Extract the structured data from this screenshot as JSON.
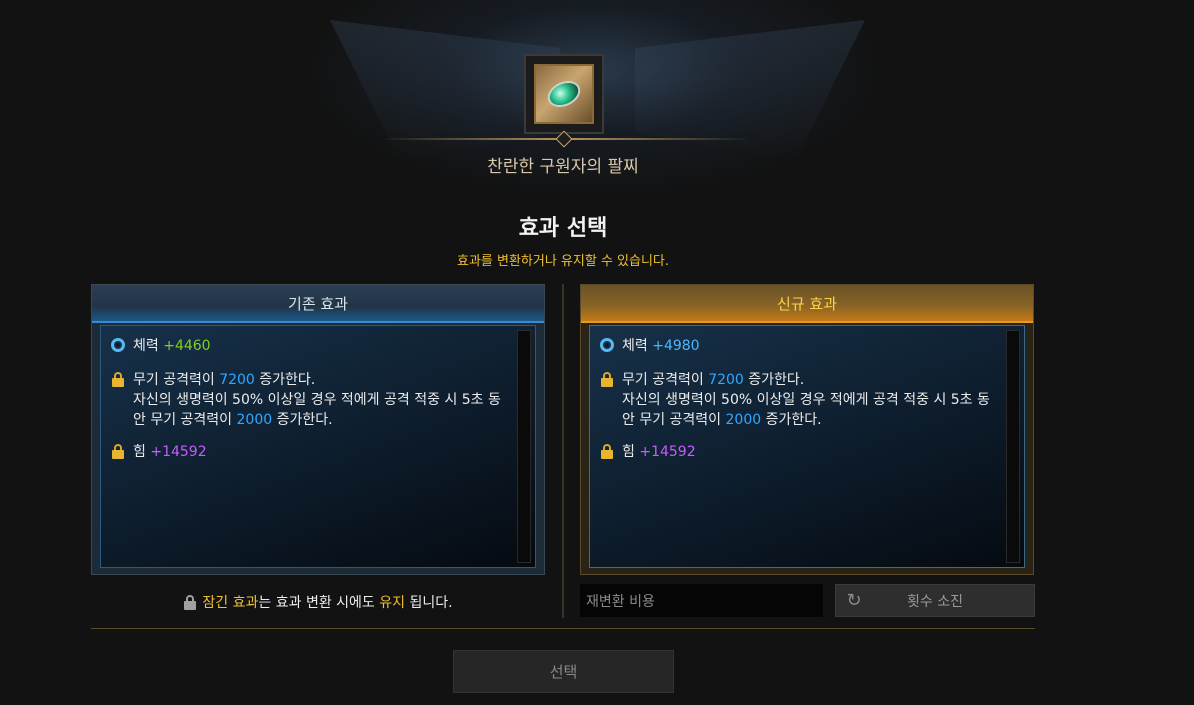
{
  "item": {
    "name": "찬란한 구원자의 팔찌",
    "icon": "bracelet-icon"
  },
  "header": {
    "title": "효과 선택",
    "subtitle": "효과를 변환하거나 유지할 수 있습니다."
  },
  "old_panel": {
    "title": "기존 효과",
    "effects": [
      {
        "icon": "stat-gear-icon",
        "label": "체력",
        "value": "+4460"
      },
      {
        "icon": "lock-icon",
        "line1_pre": "무기 공격력이 ",
        "line1_val": "7200",
        "line1_post": " 증가한다.",
        "line2": "자신의 생명력이 50% 이상일 경우 적에게 공격 적중 시 5초 동",
        "line3_pre": "안 무기 공격력이 ",
        "line3_val": "2000",
        "line3_post": " 증가한다."
      },
      {
        "icon": "lock-icon",
        "label": "힘",
        "value": "+14592"
      }
    ]
  },
  "new_panel": {
    "title": "신규 효과",
    "effects": [
      {
        "icon": "stat-gear-icon",
        "label": "체력",
        "value": "+4980"
      },
      {
        "icon": "lock-icon",
        "line1_pre": "무기 공격력이 ",
        "line1_val": "7200",
        "line1_post": " 증가한다.",
        "line2": "자신의 생명력이 50% 이상일 경우 적에게 공격 적중 시 5초 동",
        "line3_pre": "안 무기 공격력이 ",
        "line3_val": "2000",
        "line3_post": " 증가한다."
      },
      {
        "icon": "lock-icon",
        "label": "힘",
        "value": "+14592"
      }
    ]
  },
  "footnote": {
    "hl1": "잠긴 효과",
    "mid": "는 효과 변환 시에도 ",
    "hl2": "유지",
    "end": " 됩니다."
  },
  "cost": {
    "label": "재변환 비용"
  },
  "count_button": {
    "label": "횟수 소진",
    "icon": "refresh-icon"
  },
  "select_button": {
    "label": "선택"
  },
  "colors": {
    "gold": "#f0c030",
    "green": "#7ed321",
    "blue": "#2fa8ff",
    "purple": "#c85cff"
  }
}
